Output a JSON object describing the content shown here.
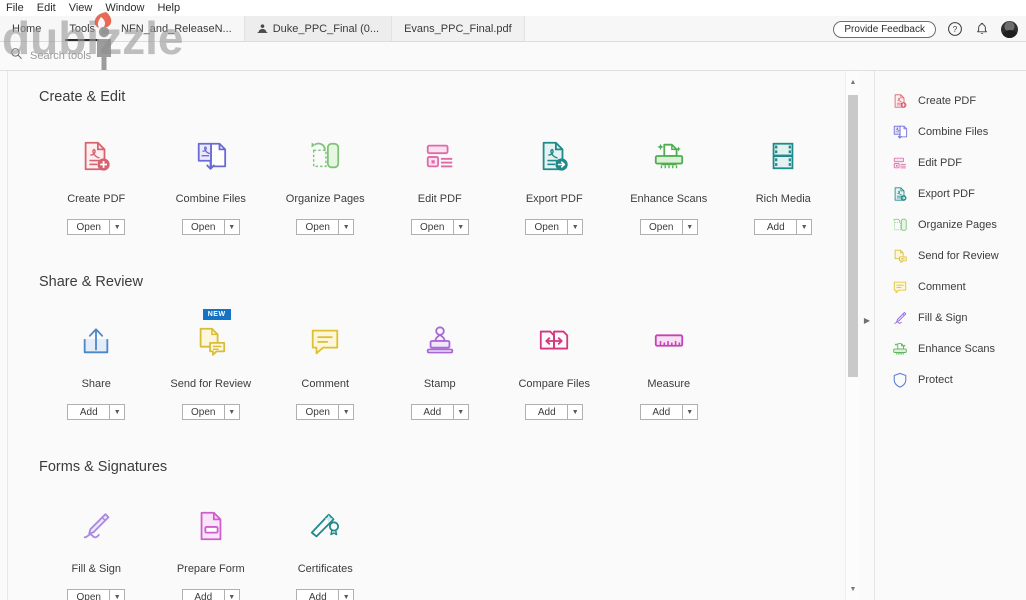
{
  "menubar": {
    "items": [
      "File",
      "Edit",
      "View",
      "Window",
      "Help"
    ]
  },
  "tabs": [
    {
      "label": "Home",
      "name": "tab-home",
      "active": false
    },
    {
      "label": "Tools",
      "name": "tab-tools",
      "active": true
    },
    {
      "label": "NFN_and_ReleaseN...",
      "name": "tab-nfn",
      "active": false
    },
    {
      "label": "Duke_PPC_Final (0...",
      "name": "tab-duke",
      "active": false,
      "icon": "shared-user-icon"
    },
    {
      "label": "Evans_PPC_Final.pdf",
      "name": "tab-evans",
      "active": false
    }
  ],
  "header": {
    "feedback_label": "Provide Feedback",
    "help_icon": "help-circle-icon",
    "bell_icon": "notification-bell-icon",
    "avatar_icon": "user-avatar"
  },
  "search": {
    "placeholder": "Search tools",
    "icon": "search-icon",
    "value": ""
  },
  "watermark": {
    "text": "dubizzle",
    "color": "#9a9a9a",
    "flame_color": "#e4523a"
  },
  "sections": [
    {
      "title": "Create & Edit",
      "name": "section-create-edit",
      "tools": [
        {
          "label": "Create PDF",
          "action": "Open",
          "icon": "create-pdf-icon",
          "color": "#d6636f"
        },
        {
          "label": "Combine Files",
          "action": "Open",
          "icon": "combine-files-icon",
          "color": "#6a6ad6"
        },
        {
          "label": "Organize Pages",
          "action": "Open",
          "icon": "organize-pages-icon",
          "color": "#7cc576"
        },
        {
          "label": "Edit PDF",
          "action": "Open",
          "icon": "edit-pdf-icon",
          "color": "#e06aa8"
        },
        {
          "label": "Export PDF",
          "action": "Open",
          "icon": "export-pdf-icon",
          "color": "#1e8a8a"
        },
        {
          "label": "Enhance Scans",
          "action": "Open",
          "icon": "enhance-scans-icon",
          "color": "#4fad51"
        },
        {
          "label": "Rich Media",
          "action": "Add",
          "icon": "rich-media-icon",
          "color": "#1e8a8a"
        }
      ]
    },
    {
      "title": "Share & Review",
      "name": "section-share-review",
      "tools": [
        {
          "label": "Share",
          "action": "Add",
          "icon": "share-icon",
          "color": "#4a86c8"
        },
        {
          "label": "Send for Review",
          "action": "Open",
          "icon": "send-review-icon",
          "color": "#d6be3a",
          "badge": "NEW"
        },
        {
          "label": "Comment",
          "action": "Open",
          "icon": "comment-icon",
          "color": "#dcc22e"
        },
        {
          "label": "Stamp",
          "action": "Add",
          "icon": "stamp-icon",
          "color": "#a967d6"
        },
        {
          "label": "Compare Files",
          "action": "Add",
          "icon": "compare-files-icon",
          "color": "#d6357f"
        },
        {
          "label": "Measure",
          "action": "Add",
          "icon": "measure-icon",
          "color": "#c840b8"
        }
      ]
    },
    {
      "title": "Forms & Signatures",
      "name": "section-forms-signatures",
      "tools": [
        {
          "label": "Fill & Sign",
          "action": "Open",
          "icon": "fill-sign-icon",
          "color": "#a98ade"
        },
        {
          "label": "Prepare Form",
          "action": "Add",
          "icon": "prepare-form-icon",
          "color": "#cc5fcc"
        },
        {
          "label": "Certificates",
          "action": "Add",
          "icon": "certificates-icon",
          "color": "#1e8a8a"
        }
      ]
    }
  ],
  "sidebar": {
    "items": [
      {
        "label": "Create PDF",
        "icon": "create-pdf-icon",
        "color": "#d6636f"
      },
      {
        "label": "Combine Files",
        "icon": "combine-files-icon",
        "color": "#6a6ad6"
      },
      {
        "label": "Edit PDF",
        "icon": "edit-pdf-icon",
        "color": "#e06aa8"
      },
      {
        "label": "Export PDF",
        "icon": "export-pdf-icon",
        "color": "#1e8a8a"
      },
      {
        "label": "Organize Pages",
        "icon": "organize-pages-icon",
        "color": "#7cc576"
      },
      {
        "label": "Send for Review",
        "icon": "send-review-icon",
        "color": "#d6be3a"
      },
      {
        "label": "Comment",
        "icon": "comment-icon",
        "color": "#dcc22e"
      },
      {
        "label": "Fill & Sign",
        "icon": "fill-sign-icon",
        "color": "#8a5fd6"
      },
      {
        "label": "Enhance Scans",
        "icon": "enhance-scans-icon",
        "color": "#4fad51"
      },
      {
        "label": "Protect",
        "icon": "protect-icon",
        "color": "#5a7fd6"
      }
    ]
  },
  "scrollbar": {
    "up_arrow": "chevron-up-icon",
    "down_arrow": "chevron-down-icon"
  },
  "collapse": {
    "icon": "chevron-right-icon"
  }
}
